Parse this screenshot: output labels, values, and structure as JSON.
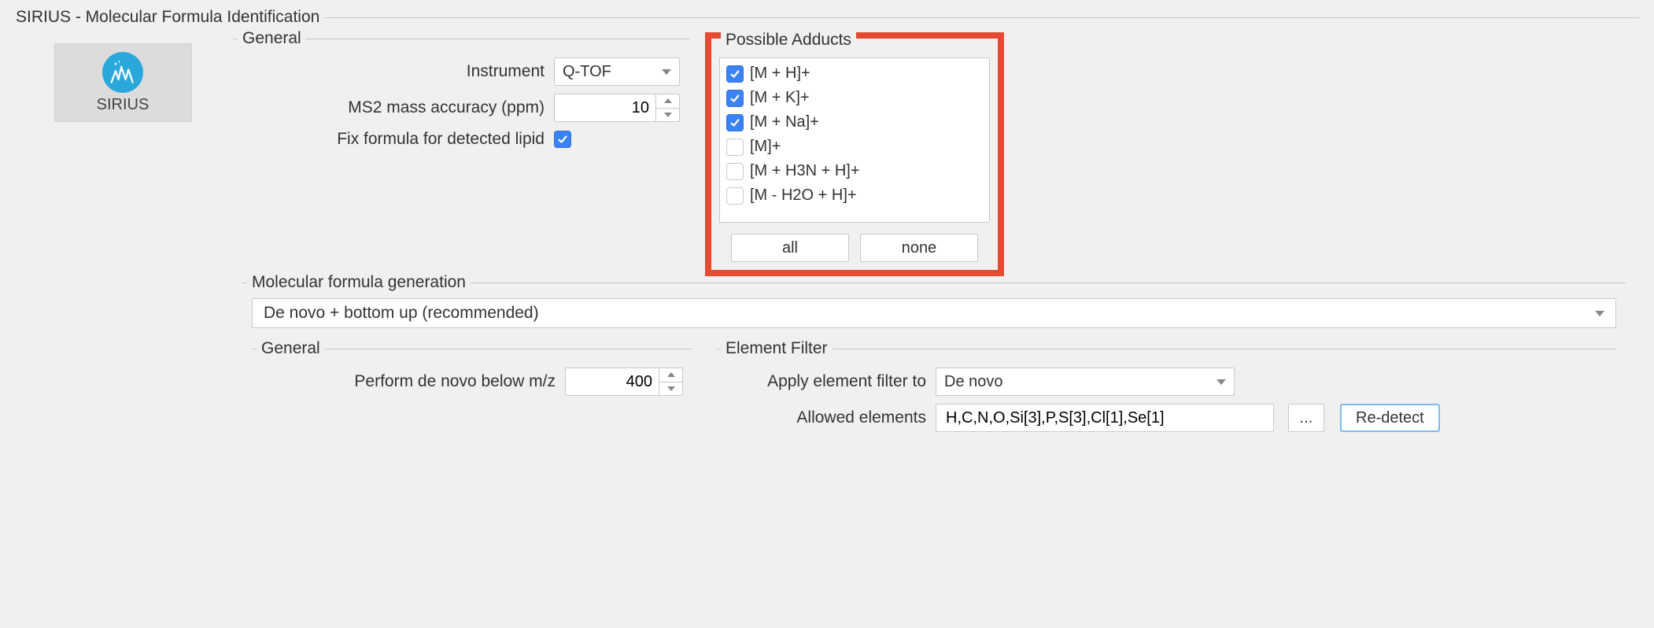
{
  "main_group_title": "SIRIUS - Molecular Formula Identification",
  "sirius": {
    "label": "SIRIUS"
  },
  "general": {
    "title": "General",
    "instrument_label": "Instrument",
    "instrument_value": "Q-TOF",
    "ms2_label": "MS2 mass accuracy (ppm)",
    "ms2_value": "10",
    "lipid_label": "Fix formula for detected lipid",
    "lipid_checked": true
  },
  "adducts": {
    "title": "Possible Adducts",
    "items": [
      {
        "label": "[M + H]+",
        "checked": true
      },
      {
        "label": "[M + K]+",
        "checked": true
      },
      {
        "label": "[M + Na]+",
        "checked": true
      },
      {
        "label": "[M]+",
        "checked": false
      },
      {
        "label": "[M + H3N + H]+",
        "checked": false
      },
      {
        "label": "[M - H2O + H]+",
        "checked": false
      }
    ],
    "all_label": "all",
    "none_label": "none"
  },
  "mfg": {
    "title": "Molecular formula generation",
    "strategy": "De novo + bottom up (recommended)",
    "general": {
      "title": "General",
      "denovo_label": "Perform de novo below m/z",
      "denovo_value": "400"
    },
    "ef": {
      "title": "Element Filter",
      "apply_label": "Apply element filter to",
      "apply_value": "De novo",
      "allowed_label": "Allowed elements",
      "allowed_value": "H,C,N,O,Si[3],P,S[3],Cl[1],Se[1]",
      "more_label": "...",
      "redetect_label": "Re-detect"
    }
  }
}
